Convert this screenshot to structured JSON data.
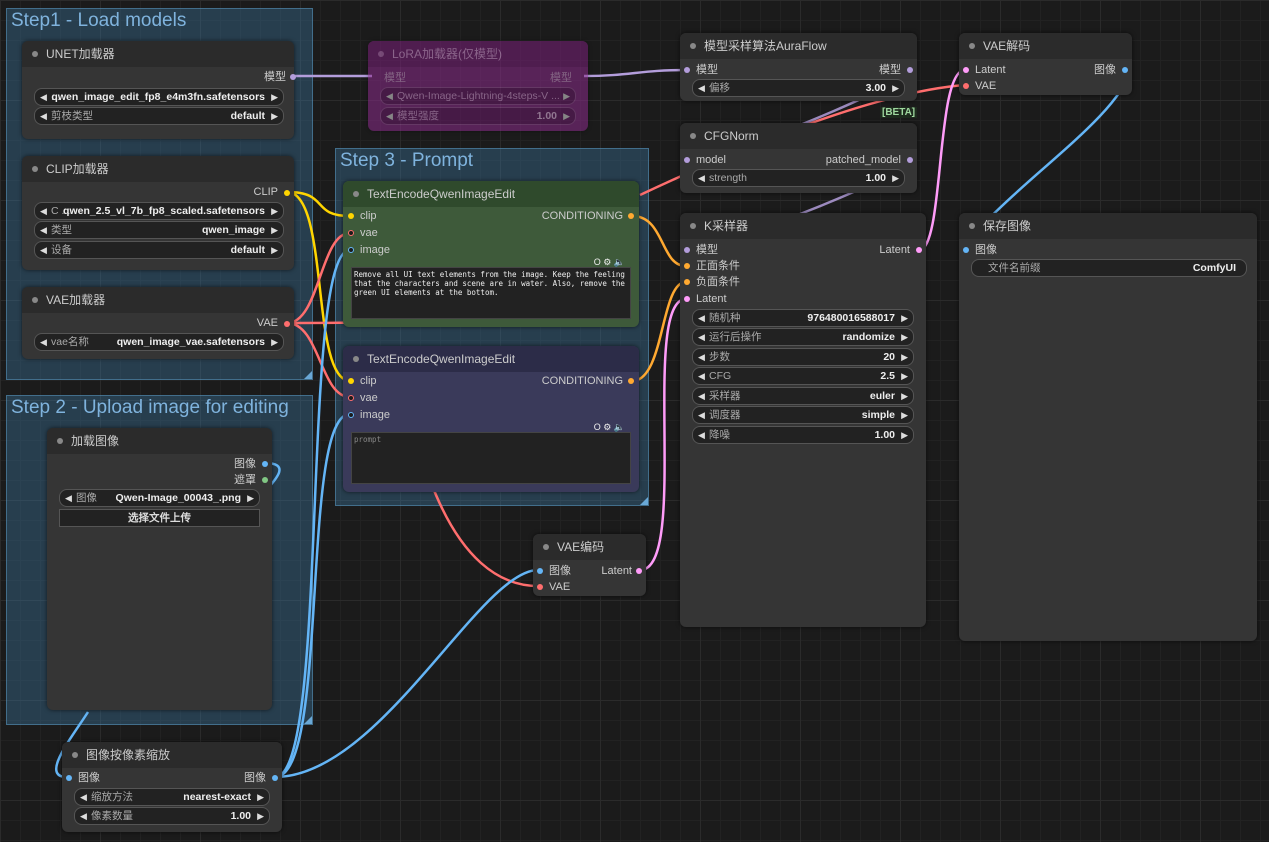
{
  "groups": {
    "step1": "Step1 - Load models",
    "step2": "Step 2 - Upload image for editing",
    "step3": "Step 3 - Prompt"
  },
  "nodes": {
    "unet": {
      "title": "UNET加载器",
      "out_model": "模型",
      "w_unet_label": "...",
      "w_unet_value": "qwen_image_edit_fp8_e4m3fn.safetensors",
      "w_dtype_label": "剪枝类型",
      "w_dtype_value": "default"
    },
    "clip": {
      "title": "CLIP加载器",
      "out_clip": "CLIP",
      "w_clip_label": "C ...",
      "w_clip_value": "qwen_2.5_vl_7b_fp8_scaled.safetensors",
      "w_type_label": "类型",
      "w_type_value": "qwen_image",
      "w_device_label": "设备",
      "w_device_value": "default"
    },
    "vae_loader": {
      "title": "VAE加载器",
      "out_vae": "VAE",
      "w_label": "vae名称",
      "w_value": "qwen_image_vae.safetensors"
    },
    "lora": {
      "title": "LoRA加载器(仅模型)",
      "in_model": "模型",
      "out_model": "模型",
      "w_lora_value": "Qwen-Image-Lightning-4steps-V ...",
      "w_strength_label": "模型强度",
      "w_strength_value": "1.00"
    },
    "auraflow": {
      "title": "模型采样算法AuraFlow",
      "in_model": "模型",
      "out_model": "模型",
      "w_shift_label": "偏移",
      "w_shift_value": "3.00",
      "badge": "[BETA]"
    },
    "cfgnorm": {
      "title": "CFGNorm",
      "in_model": "model",
      "out_model": "patched_model",
      "w_strength_label": "strength",
      "w_strength_value": "1.00"
    },
    "vae_decode": {
      "title": "VAE解码",
      "in_latent": "Latent",
      "in_vae": "VAE",
      "out_image": "图像"
    },
    "te_pos": {
      "title": "TextEncodeQwenImageEdit",
      "in_clip": "clip",
      "in_vae": "vae",
      "in_image": "image",
      "out": "CONDITIONING",
      "icons": "O ⚙ 🔈",
      "prompt": "Remove all UI text elements from the image. Keep the feeling that the characters and scene are in water. Also, remove the green UI elements at the bottom."
    },
    "te_neg": {
      "title": "TextEncodeQwenImageEdit",
      "in_clip": "clip",
      "in_vae": "vae",
      "in_image": "image",
      "out": "CONDITIONING",
      "icons": "O ⚙ 🔈",
      "placeholder": "prompt"
    },
    "ksampler": {
      "title": "K采样器",
      "in_model": "模型",
      "in_pos": "正面条件",
      "in_neg": "负面条件",
      "in_latent": "Latent",
      "out_latent": "Latent",
      "w_seed_label": "随机种",
      "w_seed_value": "976480016588017",
      "w_after_label": "运行后操作",
      "w_after_value": "randomize",
      "w_steps_label": "步数",
      "w_steps_value": "20",
      "w_cfg_label": "CFG",
      "w_cfg_value": "2.5",
      "w_sampler_label": "采样器",
      "w_sampler_value": "euler",
      "w_sched_label": "调度器",
      "w_sched_value": "simple",
      "w_denoise_label": "降噪",
      "w_denoise_value": "1.00"
    },
    "save": {
      "title": "保存图像",
      "in_image": "图像",
      "w_prefix_label": "文件名前缀",
      "w_prefix_value": "ComfyUI"
    },
    "load_image": {
      "title": "加载图像",
      "out_image": "图像",
      "out_mask": "遮罩",
      "w_image_label": "图像",
      "w_image_value": "Qwen-Image_00043_.png",
      "upload_btn": "选择文件上传"
    },
    "vae_encode": {
      "title": "VAE编码",
      "in_image": "图像",
      "in_vae": "VAE",
      "out_latent": "Latent"
    },
    "scale": {
      "title": "图像按像素缩放",
      "in_image": "图像",
      "out_image": "图像",
      "w_method_label": "缩放方法",
      "w_method_value": "nearest-exact",
      "w_mp_label": "像素数量",
      "w_mp_value": "1.00"
    }
  },
  "colors": {
    "model": "#b39ddb",
    "clip": "#ffd500",
    "vae": "#ff6e6e",
    "image": "#64b5f6",
    "latent": "#ff9cf9",
    "conditioning": "#ffa931",
    "mask": "#81c784"
  }
}
